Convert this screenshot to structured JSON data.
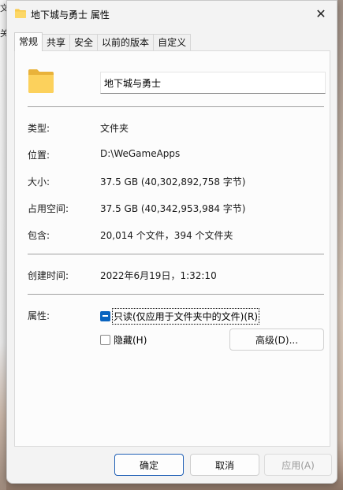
{
  "window": {
    "title": "地下城与勇士 属性",
    "close_glyph": "✕"
  },
  "tabs": [
    {
      "label": "常规",
      "active": true
    },
    {
      "label": "共享",
      "active": false
    },
    {
      "label": "安全",
      "active": false
    },
    {
      "label": "以前的版本",
      "active": false
    },
    {
      "label": "自定义",
      "active": false
    }
  ],
  "general": {
    "folder_name": "地下城与勇士",
    "type_label": "类型:",
    "type_value": "文件夹",
    "location_label": "位置:",
    "location_value": "D:\\WeGameApps",
    "size_label": "大小:",
    "size_value": "37.5 GB (40,302,892,758 字节)",
    "disk_size_label": "占用空间:",
    "disk_size_value": "37.5 GB (40,342,953,984 字节)",
    "contains_label": "包含:",
    "contains_value": "20,014 个文件，394 个文件夹",
    "created_label": "创建时间:",
    "created_value": "2022年6月19日，1:32:10",
    "attributes_label": "属性:",
    "readonly_label": "只读(仅应用于文件夹中的文件)(R)",
    "hidden_label": "隐藏(H)",
    "advanced_button": "高级(D)..."
  },
  "footer": {
    "ok": "确定",
    "cancel": "取消",
    "apply": "应用(A)"
  },
  "background": {
    "peek_top": "文",
    "peek_mid": "关"
  },
  "colors": {
    "accent": "#0a64bf",
    "folder": "#f8c94a"
  }
}
